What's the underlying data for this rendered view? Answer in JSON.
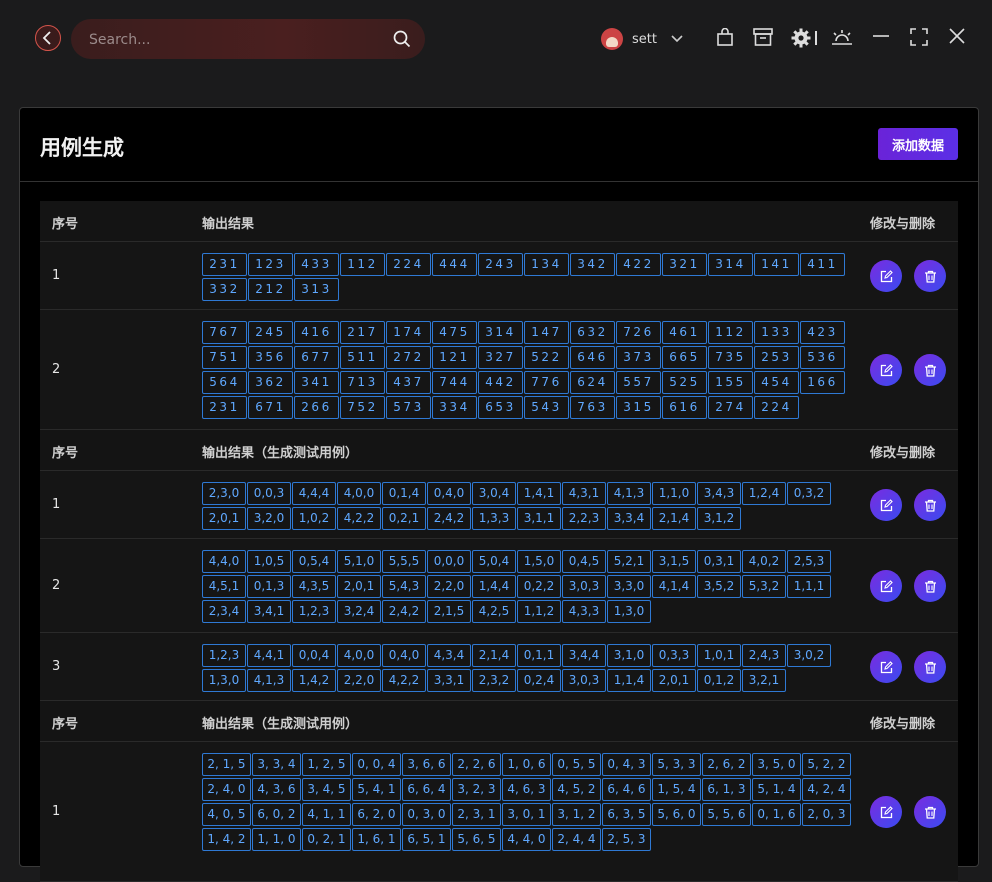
{
  "search": {
    "placeholder": "Search..."
  },
  "user": {
    "name": "sett"
  },
  "card": {
    "title": "用例生成",
    "add_label": "添加数据"
  },
  "sections": [
    {
      "headers": [
        "序号",
        "输出结果",
        "修改与删除"
      ],
      "rows": [
        {
          "index": "1",
          "tags": [
            "231",
            "123",
            "433",
            "112",
            "224",
            "444",
            "243",
            "134",
            "342",
            "422",
            "321",
            "314",
            "141",
            "411",
            "332",
            "212",
            "313"
          ]
        },
        {
          "index": "2",
          "tags": [
            "767",
            "245",
            "416",
            "217",
            "174",
            "475",
            "314",
            "147",
            "632",
            "726",
            "461",
            "112",
            "133",
            "423",
            "751",
            "356",
            "677",
            "511",
            "272",
            "121",
            "327",
            "522",
            "646",
            "373",
            "665",
            "735",
            "253",
            "536",
            "564",
            "362",
            "341",
            "713",
            "437",
            "744",
            "442",
            "776",
            "624",
            "557",
            "525",
            "155",
            "454",
            "166",
            "231",
            "671",
            "266",
            "752",
            "573",
            "334",
            "653",
            "543",
            "763",
            "315",
            "616",
            "274",
            "224"
          ]
        }
      ]
    },
    {
      "headers": [
        "序号",
        "输出结果（生成测试用例）",
        "修改与删除"
      ],
      "rows": [
        {
          "index": "1",
          "tags": [
            "2,3,0",
            "0,0,3",
            "4,4,4",
            "4,0,0",
            "0,1,4",
            "0,4,0",
            "3,0,4",
            "1,4,1",
            "4,3,1",
            "4,1,3",
            "1,1,0",
            "3,4,3",
            "1,2,4",
            "0,3,2",
            "2,0,1",
            "3,2,0",
            "1,0,2",
            "4,2,2",
            "0,2,1",
            "2,4,2",
            "1,3,3",
            "3,1,1",
            "2,2,3",
            "3,3,4",
            "2,1,4",
            "3,1,2"
          ]
        },
        {
          "index": "2",
          "tags": [
            "4,4,0",
            "1,0,5",
            "0,5,4",
            "5,1,0",
            "5,5,5",
            "0,0,0",
            "5,0,4",
            "1,5,0",
            "0,4,5",
            "5,2,1",
            "3,1,5",
            "0,3,1",
            "4,0,2",
            "2,5,3",
            "4,5,1",
            "0,1,3",
            "4,3,5",
            "2,0,1",
            "5,4,3",
            "2,2,0",
            "1,4,4",
            "0,2,2",
            "3,0,3",
            "3,3,0",
            "4,1,4",
            "3,5,2",
            "5,3,2",
            "1,1,1",
            "2,3,4",
            "3,4,1",
            "1,2,3",
            "3,2,4",
            "2,4,2",
            "2,1,5",
            "4,2,5",
            "1,1,2",
            "4,3,3",
            "1,3,0"
          ]
        },
        {
          "index": "3",
          "tags": [
            "1,2,3",
            "4,4,1",
            "0,0,4",
            "4,0,0",
            "0,4,0",
            "4,3,4",
            "2,1,4",
            "0,1,1",
            "3,4,4",
            "3,1,0",
            "0,3,3",
            "1,0,1",
            "2,4,3",
            "3,0,2",
            "1,3,0",
            "4,1,3",
            "1,4,2",
            "2,2,0",
            "4,2,2",
            "3,3,1",
            "2,3,2",
            "0,2,4",
            "3,0,3",
            "1,1,4",
            "2,0,1",
            "0,1,2",
            "3,2,1"
          ]
        }
      ]
    },
    {
      "headers": [
        "序号",
        "输出结果（生成测试用例）",
        "修改与删除"
      ],
      "rows": [
        {
          "index": "1",
          "tags": [
            "2, 1, 5",
            "3, 3, 4",
            "1, 2, 5",
            "0, 0, 4",
            "3, 6, 6",
            "2, 2, 6",
            "1, 0, 6",
            "0, 5, 5",
            "0, 4, 3",
            "5, 3, 3",
            "2, 6, 2",
            "3, 5, 0",
            "5, 2, 2",
            "2, 4, 0",
            "4, 3, 6",
            "3, 4, 5",
            "5, 4, 1",
            "6, 6, 4",
            "3, 2, 3",
            "4, 6, 3",
            "4, 5, 2",
            "6, 4, 6",
            "1, 5, 4",
            "6, 1, 3",
            "5, 1, 4",
            "4, 2, 4",
            "4, 0, 5",
            "6, 0, 2",
            "4, 1, 1",
            "6, 2, 0",
            "0, 3, 0",
            "2, 3, 1",
            "3, 0, 1",
            "3, 1, 2",
            "6, 3, 5",
            "5, 6, 0",
            "5, 5, 6",
            "0, 1, 6",
            "2, 0, 3",
            "1, 4, 2",
            "1, 1, 0",
            "0, 2, 1",
            "1, 6, 1",
            "6, 5, 1",
            "5, 6, 5",
            "4, 4, 0",
            "2, 4, 4",
            "2, 5, 3"
          ]
        }
      ]
    }
  ]
}
